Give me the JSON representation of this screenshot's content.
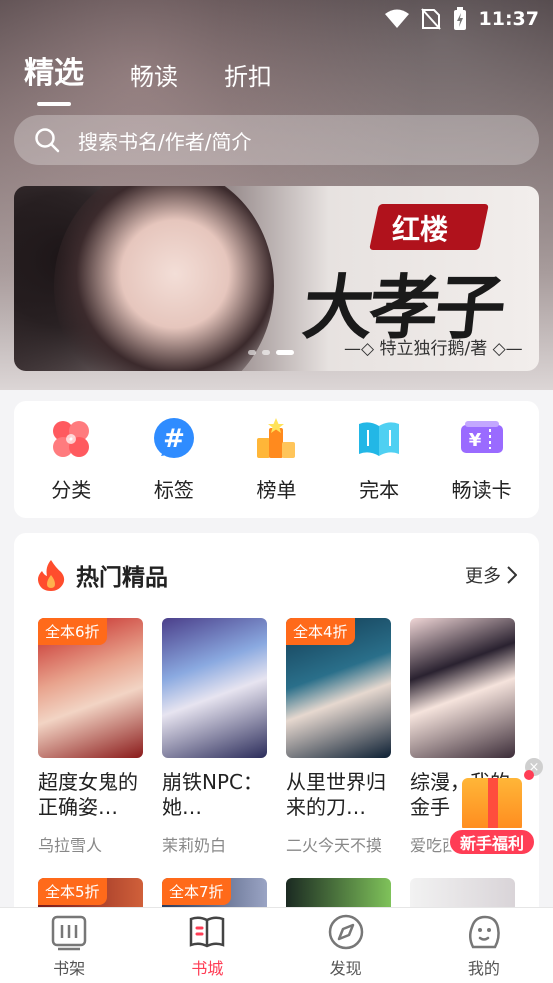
{
  "status_bar": {
    "time": "11:37"
  },
  "top_tabs": [
    {
      "label": "精选",
      "active": true
    },
    {
      "label": "畅读",
      "active": false
    },
    {
      "label": "折扣",
      "active": false
    }
  ],
  "search": {
    "placeholder": "搜索书名/作者/简介"
  },
  "banner": {
    "tag": "红楼",
    "title": "大孝子",
    "author": "—◇ 特立独行鹅/著 ◇—"
  },
  "categories": [
    {
      "label": "分类",
      "icon": "clover-icon",
      "color": "#ff5a5f"
    },
    {
      "label": "标签",
      "icon": "hashtag-icon",
      "color": "#2f8cff"
    },
    {
      "label": "榜单",
      "icon": "podium-icon",
      "color": "#ff9a1e"
    },
    {
      "label": "完本",
      "icon": "book-open-icon",
      "color": "#22b7e6"
    },
    {
      "label": "畅读卡",
      "icon": "yen-card-icon",
      "color": "#9a6bff"
    }
  ],
  "hot_section": {
    "title": "热门精品",
    "more": "更多",
    "books": [
      {
        "title": "超度女鬼的正确姿…",
        "author": "乌拉雪人",
        "badge": "全本6折"
      },
      {
        "title": "崩铁NPC：她…",
        "author": "茉莉奶白",
        "badge": ""
      },
      {
        "title": "从里世界归来的刀…",
        "author": "二火今天不摸",
        "badge": "全本4折"
      },
      {
        "title": "综漫，我的金手",
        "author": "爱吃西",
        "badge": ""
      }
    ],
    "second_row_badges": [
      "全本5折",
      "全本7折",
      "",
      ""
    ]
  },
  "gift": {
    "label": "新手福利",
    "close": "×"
  },
  "bottom_nav": [
    {
      "label": "书架",
      "icon": "bookshelf-icon",
      "active": false
    },
    {
      "label": "书城",
      "icon": "bookstore-icon",
      "active": true
    },
    {
      "label": "发现",
      "icon": "compass-icon",
      "active": false
    },
    {
      "label": "我的",
      "icon": "profile-icon",
      "active": false
    }
  ],
  "colors": {
    "accent": "#ff3d55",
    "badge": "#ff6a1a"
  }
}
